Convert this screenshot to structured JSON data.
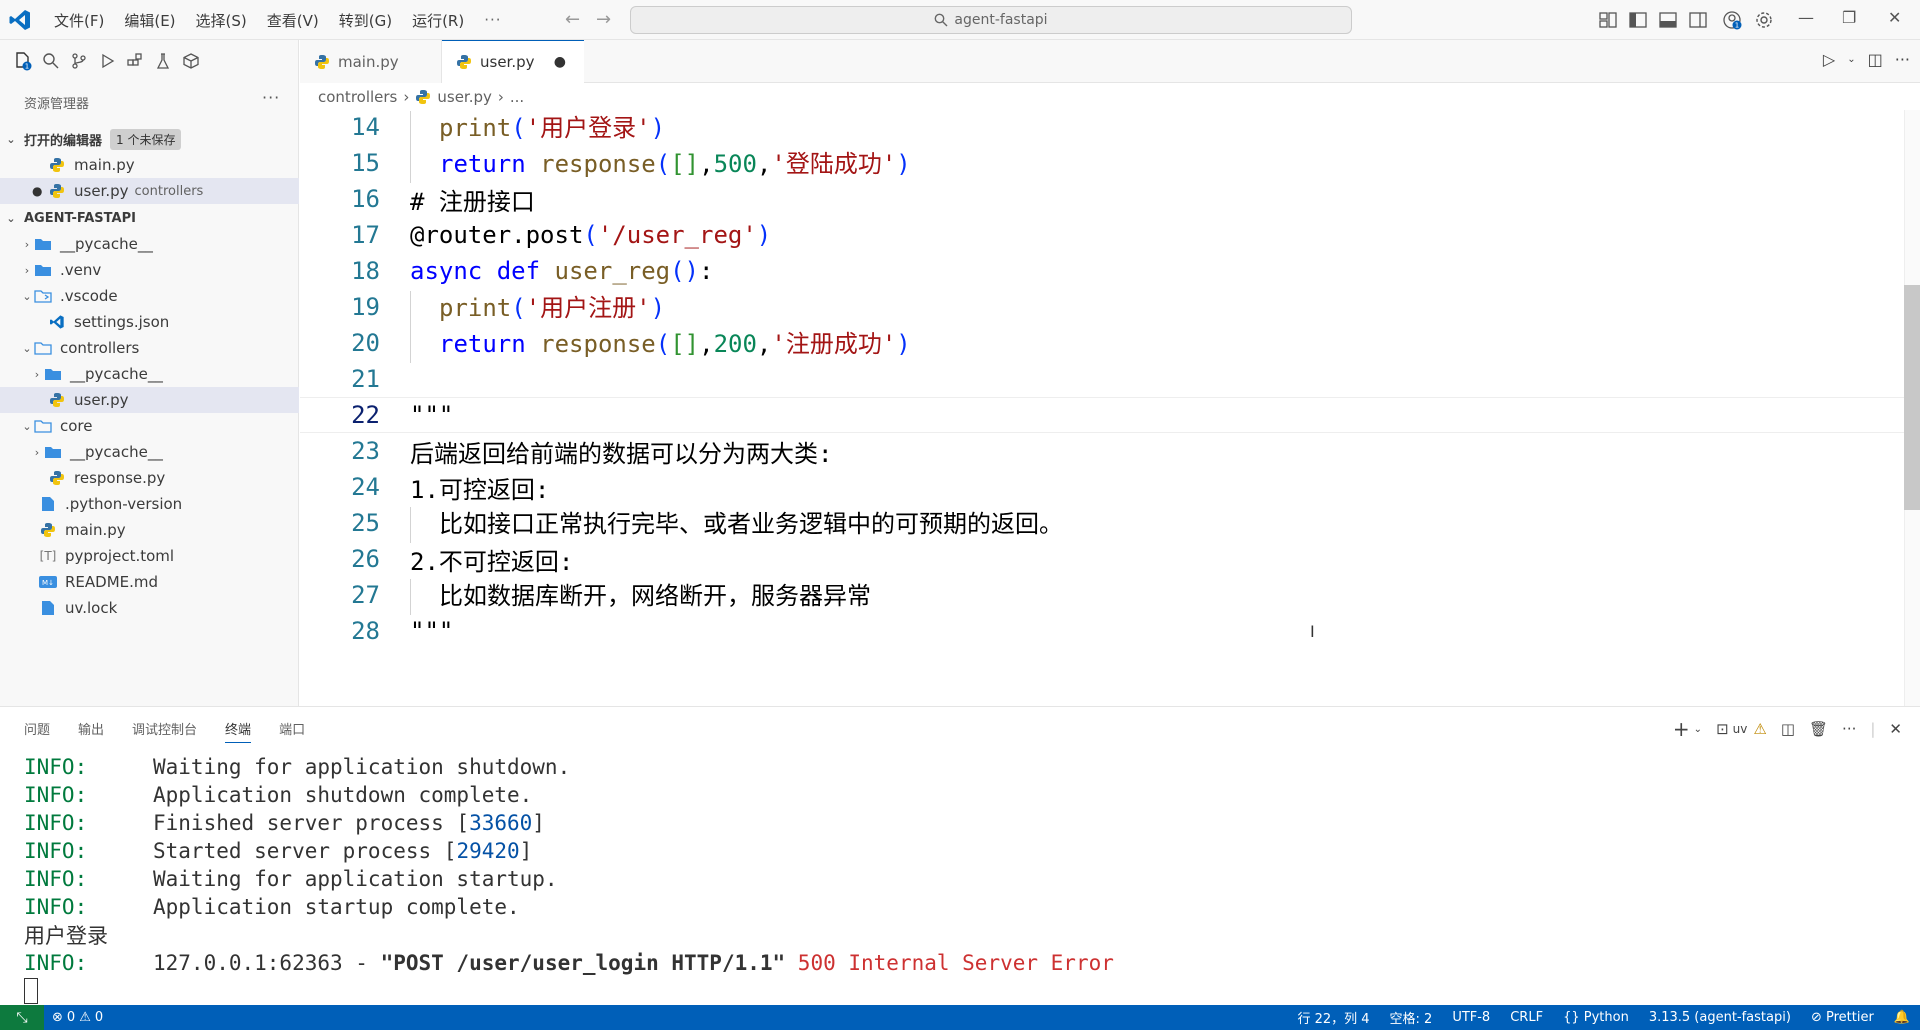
{
  "titlebar": {
    "menus": [
      "文件(F)",
      "编辑(E)",
      "选择(S)",
      "查看(V)",
      "转到(G)",
      "运行(R)",
      "···"
    ],
    "search": "agent-fastapi"
  },
  "explorer": {
    "title": "资源管理器",
    "open_editors_label": "打开的编辑器",
    "unsaved_badge": "1 个未保存",
    "open_editors": [
      {
        "name": "main.py",
        "desc": ""
      },
      {
        "name": "user.py",
        "desc": "controllers"
      }
    ],
    "project": "AGENT-FASTAPI",
    "tree": [
      {
        "name": "__pycache__"
      },
      {
        "name": ".venv"
      },
      {
        "name": ".vscode"
      },
      {
        "name": "settings.json"
      },
      {
        "name": "controllers"
      },
      {
        "name": "__pycache__"
      },
      {
        "name": "user.py"
      },
      {
        "name": "core"
      },
      {
        "name": "__pycache__"
      },
      {
        "name": "response.py"
      },
      {
        "name": ".python-version"
      },
      {
        "name": "main.py"
      },
      {
        "name": "pyproject.toml"
      },
      {
        "name": "README.md"
      },
      {
        "name": "uv.lock"
      }
    ]
  },
  "tabs": [
    {
      "label": "main.py"
    },
    {
      "label": "user.py"
    }
  ],
  "breadcrumb": {
    "folder": "controllers",
    "file": "user.py",
    "rest": "..."
  },
  "code": {
    "line_numbers": [
      "14",
      "15",
      "16",
      "17",
      "18",
      "19",
      "20",
      "21",
      "22",
      "23",
      "24",
      "25",
      "26",
      "27",
      "28"
    ],
    "l14_fn": "print",
    "l14_str": "'用户登录'",
    "l15_kw": "return",
    "l15_fn": "response",
    "l15_num": "500",
    "l15_str": "'登陆成功'",
    "l16_comment": "# 注册接口",
    "l17_dec": "@router.post",
    "l17_str": "'/user_reg'",
    "l18_kw1": "async",
    "l18_kw2": "def",
    "l18_fn": "user_reg",
    "l19_fn": "print",
    "l19_str": "'用户注册'",
    "l20_kw": "return",
    "l20_fn": "response",
    "l20_num": "200",
    "l20_str": "'注册成功'",
    "l22": "\"\"\"",
    "l23": "后端返回给前端的数据可以分为两大类:",
    "l24": "1.可控返回:",
    "l25": "比如接口正常执行完毕、或者业务逻辑中的可预期的返回。",
    "l26": "2.不可控返回:",
    "l27": "比如数据库断开，网络断开，服务器异常",
    "l28": "\"\"\""
  },
  "panel": {
    "tabs": [
      "问题",
      "输出",
      "调试控制台",
      "终端",
      "端口"
    ],
    "active_tab": "终端",
    "shell_label": "uv"
  },
  "terminal": {
    "level": "INFO:",
    "l1": "Waiting for application shutdown.",
    "l2": "Application shutdown complete.",
    "l3_pre": "Finished server process [",
    "l3_num": "33660",
    "l3_post": "]",
    "l4_pre": "Started server process [",
    "l4_num": "29420",
    "l4_post": "]",
    "l5": "Waiting for application startup.",
    "l6": "Application startup complete.",
    "l7": "用户登录",
    "l8_addr": "127.0.0.1:62363 - ",
    "l8_req": "\"POST /user/user_login HTTP/1.1\"",
    "l8_err": " 500 Internal Server Error"
  },
  "status": {
    "errors": "0",
    "warnings": "0",
    "position": "行 22，列 4",
    "spaces": "空格: 2",
    "encoding": "UTF-8",
    "eol": "CRLF",
    "language": "Python",
    "interpreter": "3.13.5 (agent-fastapi)",
    "formatter": "Prettier"
  },
  "colors": {
    "accent": "#005fb8",
    "remote": "#0d7a3e",
    "keyword": "#0000ff",
    "string": "#a31515"
  }
}
